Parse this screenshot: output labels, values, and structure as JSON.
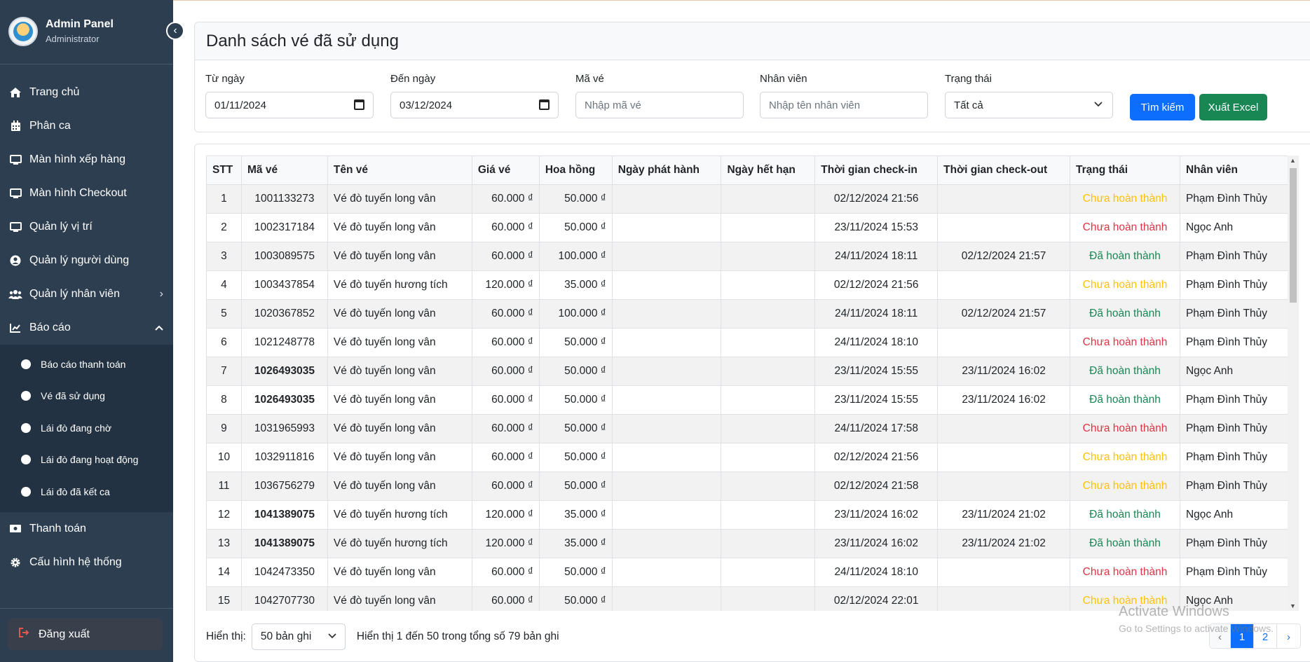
{
  "sidebar": {
    "title": "Admin Panel",
    "subtitle": "Administrator",
    "items": [
      {
        "label": "Trang chủ",
        "icon": "home-icon"
      },
      {
        "label": "Phân ca",
        "icon": "calendar-icon"
      },
      {
        "label": "Màn hình xếp hàng",
        "icon": "monitor-icon"
      },
      {
        "label": "Màn hình Checkout",
        "icon": "monitor-icon"
      },
      {
        "label": "Quản lý vị trí",
        "icon": "monitor-icon"
      },
      {
        "label": "Quản lý người dùng",
        "icon": "user-circle-icon"
      },
      {
        "label": "Quản lý nhân viên",
        "icon": "users-icon"
      },
      {
        "label": "Báo cáo",
        "icon": "chart-line-icon"
      },
      {
        "label": "Thanh toán",
        "icon": "money-icon"
      },
      {
        "label": "Cấu hình hệ thống",
        "icon": "gear-icon"
      }
    ],
    "report_sub": [
      "Báo cáo thanh toán",
      "Vé đã sử dụng",
      "Lái đò đang chờ",
      "Lái đò đang hoạt động",
      "Lái đò đã kết ca"
    ],
    "logout": "Đăng xuất"
  },
  "page": {
    "title": "Danh sách vé đã sử dụng"
  },
  "filters": {
    "from_label": "Từ ngày",
    "from_value": "01/11/2024",
    "to_label": "Đến ngày",
    "to_value": "03/12/2024",
    "code_label": "Mã vé",
    "code_placeholder": "Nhập mã vé",
    "staff_label": "Nhân viên",
    "staff_placeholder": "Nhập tên nhân viên",
    "status_label": "Trạng thái",
    "status_value": "Tất cả",
    "search_btn": "Tìm kiếm",
    "excel_btn": "Xuất Excel"
  },
  "table": {
    "headers": [
      "STT",
      "Mã vé",
      "Tên vé",
      "Giá vé",
      "Hoa hồng",
      "Ngày phát hành",
      "Ngày hết hạn",
      "Thời gian check-in",
      "Thời gian check-out",
      "Trạng thái",
      "Nhân viên"
    ],
    "rows": [
      [
        "1",
        "1001133273",
        "Vé đò tuyến long vân",
        "60.000 ₫",
        "50.000 ₫",
        "",
        "",
        "02/12/2024 21:56",
        "",
        "Chưa hoàn thành",
        "Phạm Đình Thủy"
      ],
      [
        "2",
        "1002317184",
        "Vé đò tuyến long vân",
        "60.000 ₫",
        "50.000 ₫",
        "",
        "",
        "23/11/2024 15:53",
        "",
        "Chưa hoàn thành",
        "Ngọc Anh"
      ],
      [
        "3",
        "1003089575",
        "Vé đò tuyến long vân",
        "60.000 ₫",
        "100.000 ₫",
        "",
        "",
        "24/11/2024 18:11",
        "02/12/2024 21:57",
        "Đã hoàn thành",
        "Phạm Đình Thủy"
      ],
      [
        "4",
        "1003437854",
        "Vé đò tuyến hương tích",
        "120.000 ₫",
        "35.000 ₫",
        "",
        "",
        "02/12/2024 21:56",
        "",
        "Chưa hoàn thành",
        "Phạm Đình Thủy"
      ],
      [
        "5",
        "1020367852",
        "Vé đò tuyến long vân",
        "60.000 ₫",
        "100.000 ₫",
        "",
        "",
        "24/11/2024 18:11",
        "02/12/2024 21:57",
        "Đã hoàn thành",
        "Phạm Đình Thủy"
      ],
      [
        "6",
        "1021248778",
        "Vé đò tuyến long vân",
        "60.000 ₫",
        "50.000 ₫",
        "",
        "",
        "24/11/2024 18:10",
        "",
        "Chưa hoàn thành",
        "Phạm Đình Thủy"
      ],
      [
        "7",
        "1026493035",
        "Vé đò tuyến long vân",
        "60.000 ₫",
        "50.000 ₫",
        "",
        "",
        "23/11/2024 15:55",
        "23/11/2024 16:02",
        "Đã hoàn thành",
        "Ngọc Anh"
      ],
      [
        "8",
        "1026493035",
        "Vé đò tuyến long vân",
        "60.000 ₫",
        "50.000 ₫",
        "",
        "",
        "23/11/2024 15:55",
        "23/11/2024 16:02",
        "Đã hoàn thành",
        "Phạm Đình Thủy"
      ],
      [
        "9",
        "1031965993",
        "Vé đò tuyến long vân",
        "60.000 ₫",
        "50.000 ₫",
        "",
        "",
        "24/11/2024 17:58",
        "",
        "Chưa hoàn thành",
        "Phạm Đình Thủy"
      ],
      [
        "10",
        "1032911816",
        "Vé đò tuyến long vân",
        "60.000 ₫",
        "50.000 ₫",
        "",
        "",
        "02/12/2024 21:56",
        "",
        "Chưa hoàn thành",
        "Phạm Đình Thủy"
      ],
      [
        "11",
        "1036756279",
        "Vé đò tuyến long vân",
        "60.000 ₫",
        "50.000 ₫",
        "",
        "",
        "02/12/2024 21:58",
        "",
        "Chưa hoàn thành",
        "Phạm Đình Thủy"
      ],
      [
        "12",
        "1041389075",
        "Vé đò tuyến hương tích",
        "120.000 ₫",
        "35.000 ₫",
        "",
        "",
        "23/11/2024 16:02",
        "23/11/2024 21:02",
        "Đã hoàn thành",
        "Ngọc Anh"
      ],
      [
        "13",
        "1041389075",
        "Vé đò tuyến hương tích",
        "120.000 ₫",
        "35.000 ₫",
        "",
        "",
        "23/11/2024 16:02",
        "23/11/2024 21:02",
        "Đã hoàn thành",
        "Phạm Đình Thủy"
      ],
      [
        "14",
        "1042473350",
        "Vé đò tuyến long vân",
        "60.000 ₫",
        "50.000 ₫",
        "",
        "",
        "24/11/2024 18:10",
        "",
        "Chưa hoàn thành",
        "Phạm Đình Thủy"
      ],
      [
        "15",
        "1042707730",
        "Vé đò tuyến long vân",
        "60.000 ₫",
        "50.000 ₫",
        "",
        "",
        "02/12/2024 22:01",
        "",
        "Chưa hoàn thành",
        "Ngọc Anh"
      ]
    ],
    "bold_codes": [
      "1026493035",
      "1041389075"
    ],
    "status_colors": {
      "red_rows": [
        2,
        6,
        9,
        14
      ],
      "warn_rows": [
        1,
        4,
        10,
        11,
        15
      ]
    }
  },
  "footer": {
    "show_label": "Hiển thị:",
    "page_size": "50 bản ghi",
    "info": "Hiển thị 1 đến 50 trong tổng số 79 bản ghi",
    "pages": [
      "‹",
      "1",
      "2",
      "›"
    ]
  },
  "watermark": {
    "line1": "Activate Windows",
    "line2": "Go to Settings to activate Windows."
  },
  "colors": {
    "sidebar_bg": "#2c3e50",
    "primary": "#0d6efd",
    "success": "#198754",
    "warning": "#ffc107",
    "danger": "#dc3545"
  }
}
